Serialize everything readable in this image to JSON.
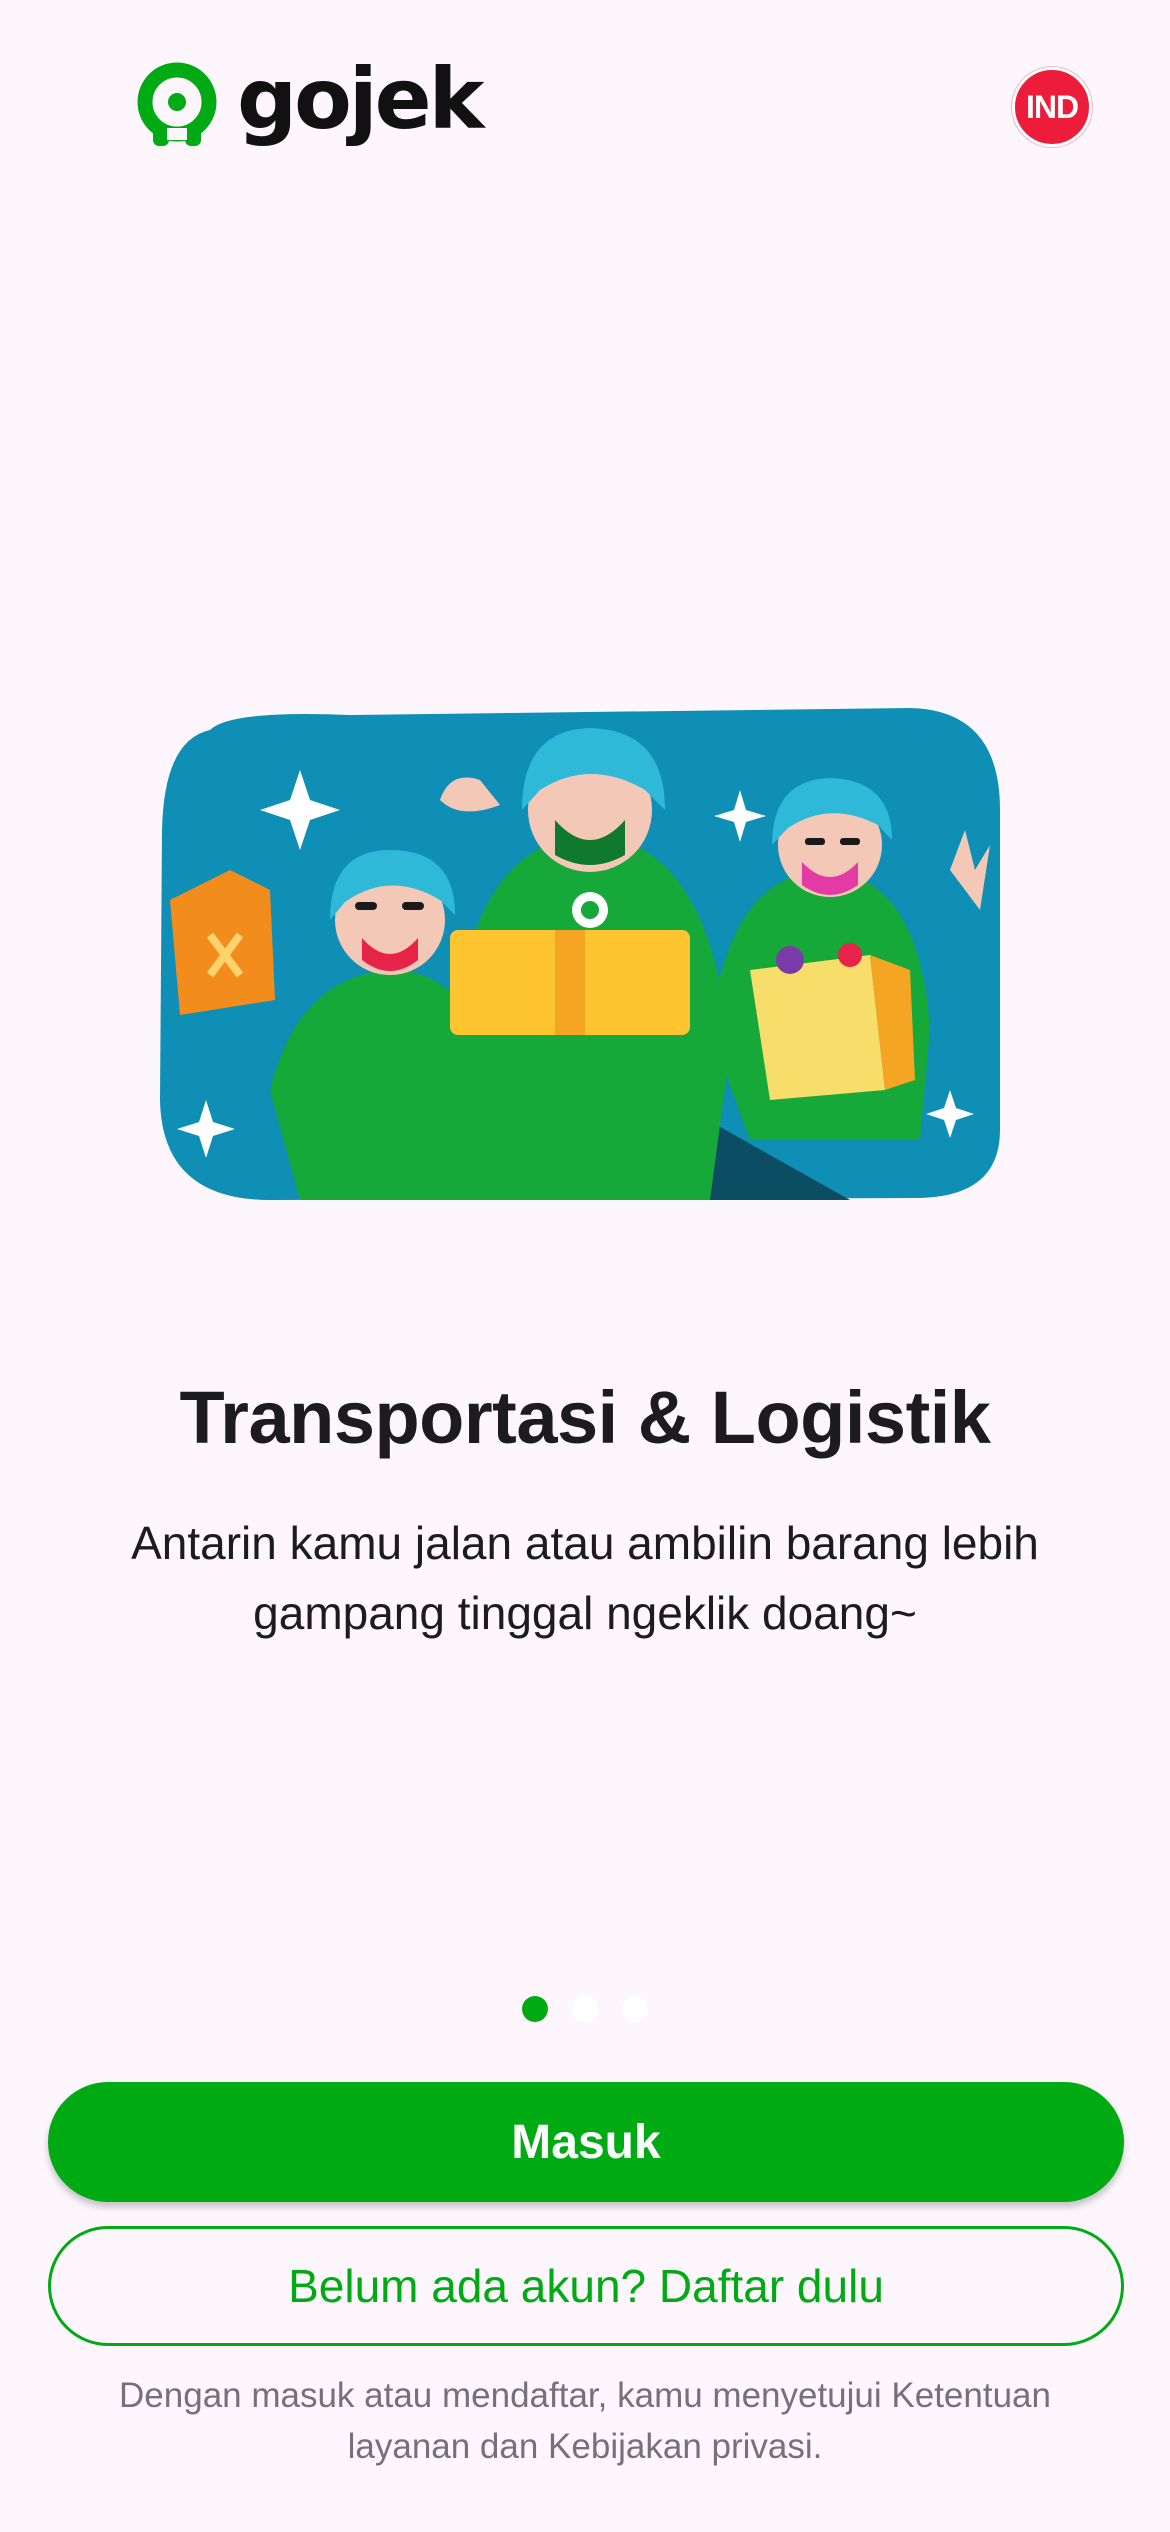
{
  "header": {
    "logo_text": "gojek",
    "logo_icon": "gojek-logo-icon",
    "language_badge": "IND"
  },
  "onboarding": {
    "illustration": "delivery-drivers-illustration",
    "title": "Transportasi & Logistik",
    "subtitle": "Antarin kamu jalan atau ambilin barang lebih gampang tinggal ngeklik doang~",
    "pagination": {
      "total": 3,
      "active": 1
    }
  },
  "actions": {
    "login_label": "Masuk",
    "register_label": "Belum ada akun? Daftar dulu"
  },
  "footer": {
    "terms_text": "Dengan masuk atau mendaftar, kamu menyetujui Ketentuan layanan dan Kebijakan privasi."
  },
  "colors": {
    "brand_green": "#00aa13",
    "badge_red": "#ec1c3a",
    "background": "#fdf7fd",
    "illustration_bg": "#0f8fb5"
  }
}
